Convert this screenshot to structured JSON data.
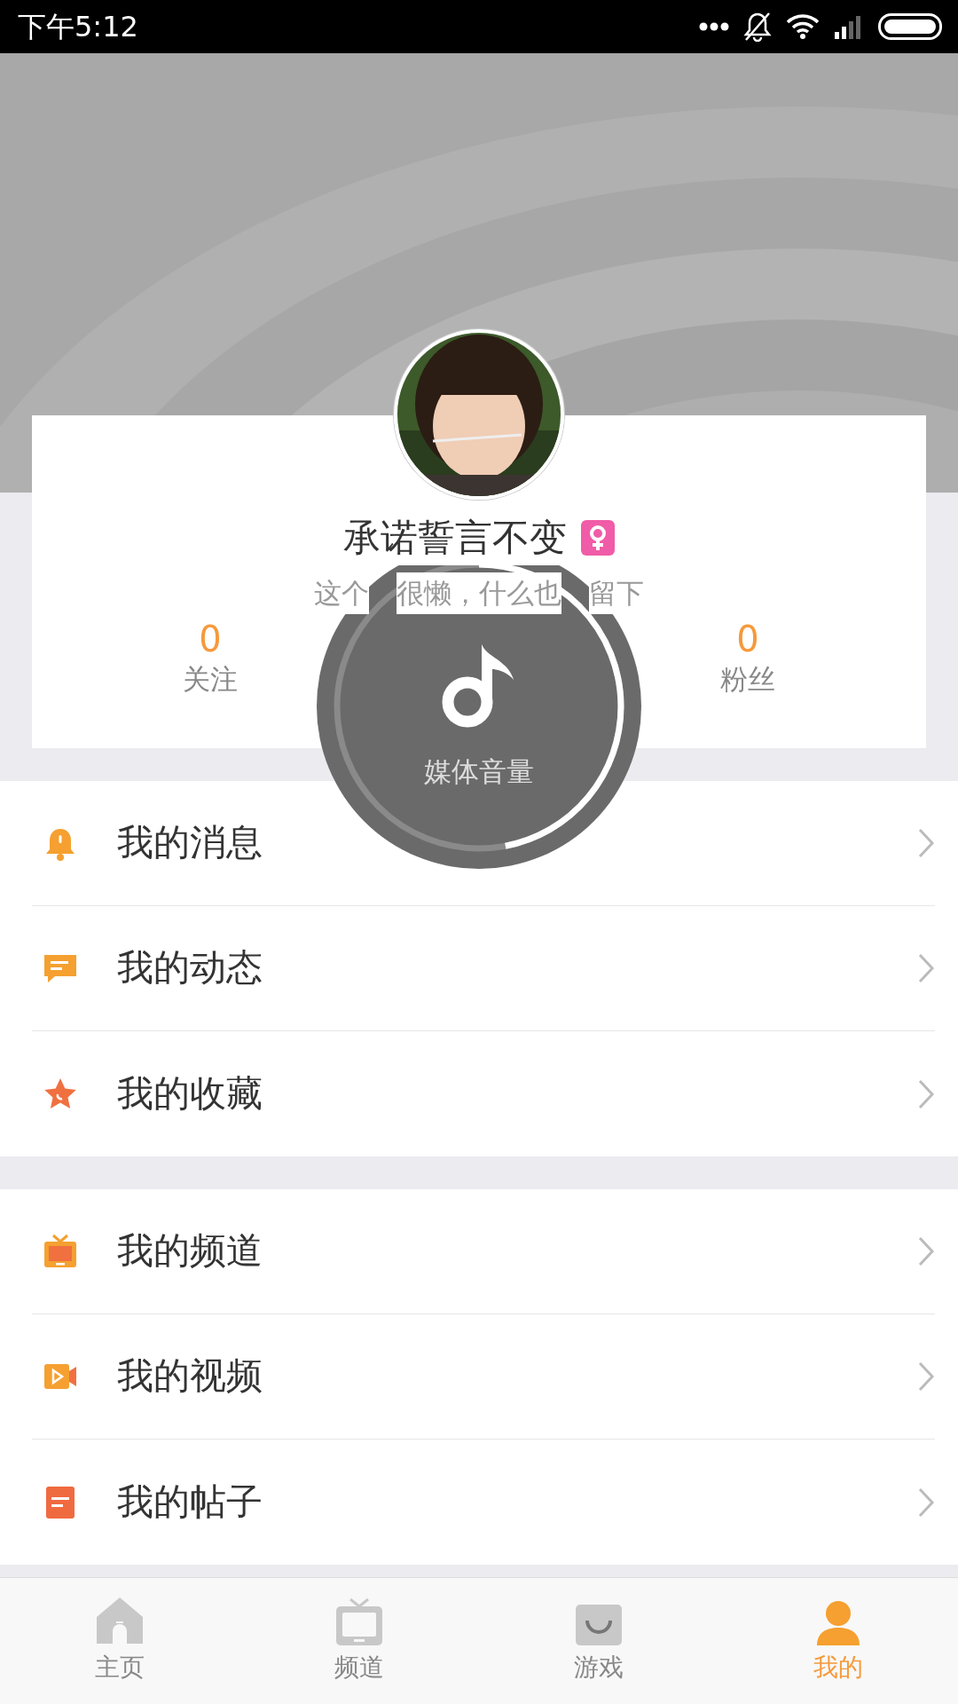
{
  "status_bar": {
    "time": "下午5:12"
  },
  "profile": {
    "name": "承诺誓言不变",
    "bio_parts": [
      "这个",
      "很懒，什么也",
      "留下"
    ],
    "stats": [
      {
        "value": "0",
        "label": "关注"
      },
      {
        "value": "0",
        "label": "粉丝"
      }
    ]
  },
  "menu_groups": [
    [
      {
        "label": "我的消息"
      },
      {
        "label": "我的动态"
      },
      {
        "label": "我的收藏"
      }
    ],
    [
      {
        "label": "我的频道"
      },
      {
        "label": "我的视频"
      },
      {
        "label": "我的帖子"
      }
    ]
  ],
  "volume_overlay": {
    "label": "媒体音量",
    "level": 0.47
  },
  "tab_bar": [
    {
      "label": "主页",
      "selected": false
    },
    {
      "label": "频道",
      "selected": false
    },
    {
      "label": "游戏",
      "selected": false
    },
    {
      "label": "我的",
      "selected": true
    }
  ]
}
